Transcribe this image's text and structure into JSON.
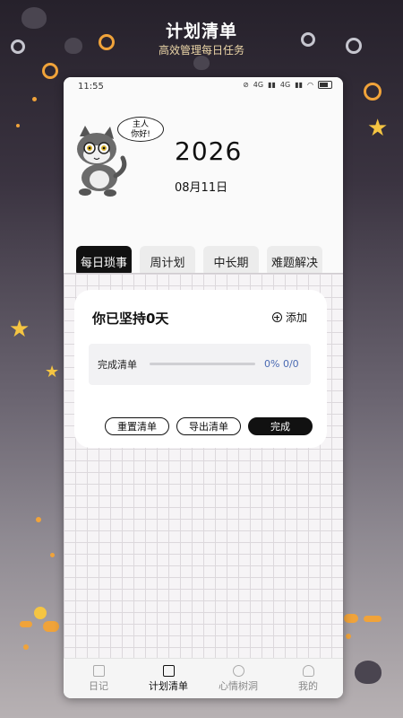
{
  "promo": {
    "title": "计划清单",
    "subtitle": "高效管理每日任务"
  },
  "status_bar": {
    "time": "11:55",
    "signal_labels": [
      "4G",
      "4G"
    ]
  },
  "header": {
    "speech_line1": "主人",
    "speech_line2": "你好!",
    "year": "2026",
    "date": "08月11日"
  },
  "tabs": [
    {
      "label": "每日琐事",
      "active": true
    },
    {
      "label": "周计划",
      "active": false
    },
    {
      "label": "中长期",
      "active": false
    },
    {
      "label": "难题解决",
      "active": false
    }
  ],
  "card": {
    "streak_text": "你已坚持0天",
    "add_label": "添加",
    "progress_label": "完成清单",
    "progress_text": "0% 0/0",
    "progress_fraction": 0,
    "reset_label": "重置清单",
    "export_label": "导出清单",
    "done_label": "完成"
  },
  "bottom_nav": [
    {
      "label": "日记",
      "icon": "diary-icon",
      "active": false
    },
    {
      "label": "计划清单",
      "icon": "checklist-icon",
      "active": true
    },
    {
      "label": "心情树洞",
      "icon": "mood-icon",
      "active": false
    },
    {
      "label": "我的",
      "icon": "profile-icon",
      "active": false
    }
  ],
  "colors": {
    "accent": "#111111",
    "progress_text": "#4a6ab3",
    "star": "#f5c542"
  }
}
